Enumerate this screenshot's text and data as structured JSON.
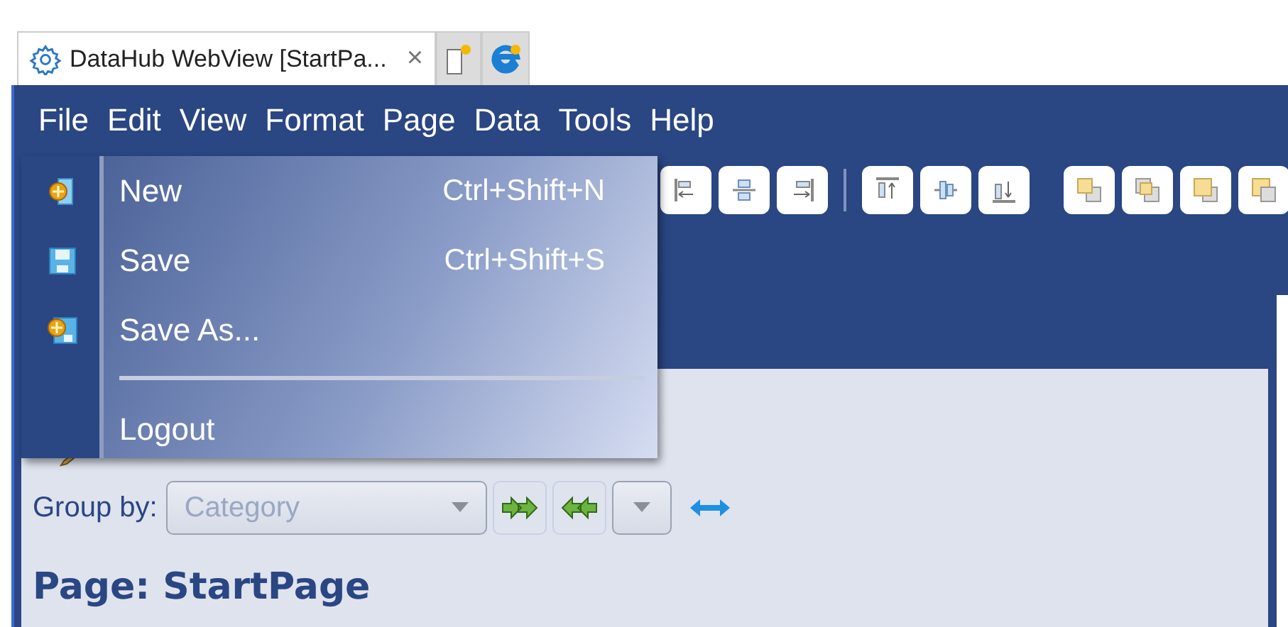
{
  "tabs": [
    {
      "kind": "page",
      "label": "DataHub WebView [StartPa...",
      "close": "×",
      "selected": true
    },
    {
      "kind": "new-page",
      "selected": false
    },
    {
      "kind": "browser",
      "selected": false
    }
  ],
  "menu_bar": [
    "File",
    "Edit",
    "View",
    "Format",
    "Page",
    "Data",
    "Tools",
    "Help"
  ],
  "file_menu": [
    {
      "kind": "new",
      "label": "New",
      "shortcut": "Ctrl+Shift+N"
    },
    {
      "kind": "save",
      "label": "Save",
      "shortcut": "Ctrl+Shift+S"
    },
    {
      "kind": "save-as",
      "label": "Save As..."
    },
    {
      "kind": "separator"
    },
    {
      "kind": "plain",
      "label": "Logout"
    }
  ],
  "group_by": {
    "label": "Group by:",
    "value": "Category",
    "disabled": true
  },
  "heading": "Page: StartPage"
}
